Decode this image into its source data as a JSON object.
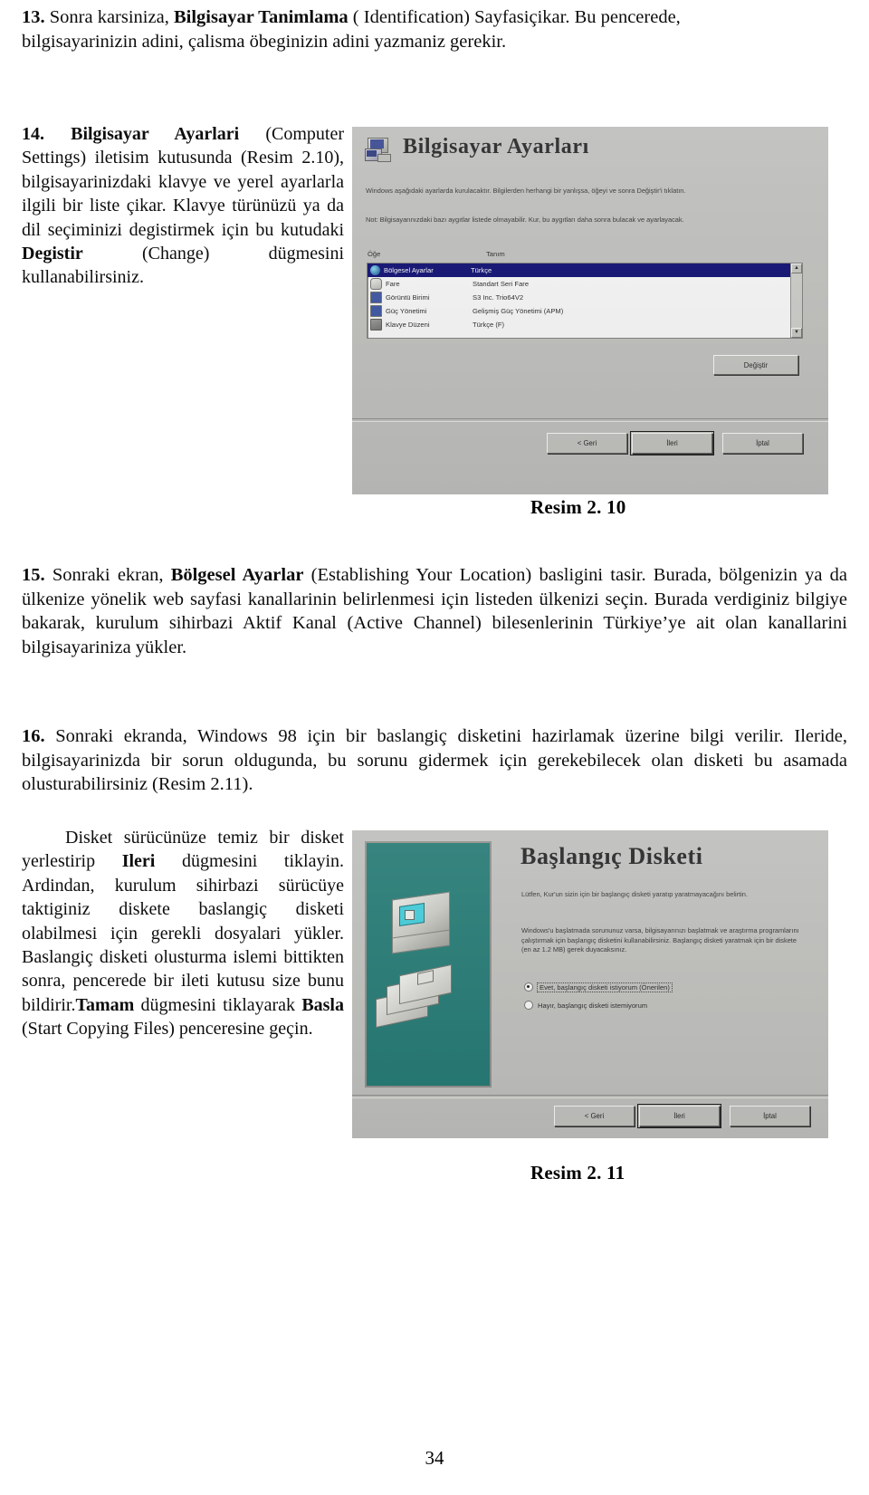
{
  "document": {
    "page_number": "34",
    "language": "tr"
  },
  "paragraphs": {
    "item13": {
      "number": "13.",
      "line1_a": " Sonra karsiniza, ",
      "bold1": "Bilgisayar Tanimlama",
      "line1_b": " ( Identification) Sayfasiçikar. Bu pencerede,",
      "line2": "bilgisayarinizin adini, çalisma öbeginizin adini yazmaniz gerekir."
    },
    "item14": {
      "number": "14.",
      "bold1": " Bilgisayar Ayarlari",
      "text_a": " (Computer Settings) iletisim kutusunda (Resim 2.10), bilgisayarinizdaki klavye ve yerel ayarlarla ilgili bir liste çikar. Klavye türünüzü ya da dil seçiminizi degistirmek için bu kutudaki ",
      "bold2": "Degistir",
      "text_b": " (Change) dügmesini kullanabilirsiniz."
    },
    "item15": {
      "number": "15.",
      "text_a": " Sonraki ekran, ",
      "bold1": "Bölgesel Ayarlar",
      "text_b": " (Establishing Your Location) basligini tasir.  Burada, bölgenizin ya da ülkenize yönelik web sayfasi kanallarinin belirlenmesi için listeden ülkenizi seçin.  Burada verdiginiz bilgiye bakarak, kurulum sihirbazi Aktif Kanal (Active Channel) bilesenlerinin Türkiye’ye ait olan kanallarini bilgisayariniza yükler."
    },
    "item16": {
      "number": "16.",
      "text": " Sonraki ekranda, Windows 98 için bir baslangiç disketini hazirlamak üzerine bilgi verilir. Ileride, bilgisayarinizda bir sorun oldugunda, bu sorunu gidermek için gerekebilecek olan disketi bu asamada olusturabilirsiniz (Resim 2.11)."
    },
    "item17": {
      "text_a": "Disket sürücünüze temiz bir disket yerlestirip ",
      "bold1": "Ileri",
      "text_b": " dügmesini tiklayin. Ardindan, kurulum sihirbazi sürücüye taktiginiz diskete baslangiç disketi olabilmesi için gerekli dosyalari yükler. Baslangiç disketi olusturma islemi bittikten sonra, pencerede bir ileti kutusu size bunu bildirir.",
      "bold2": "Tamam",
      "text_c": " dügmesini tiklayarak ",
      "bold3": "Basla",
      "text_d": " (Start Copying Files) penceresine geçin."
    }
  },
  "figures": {
    "fig_210": {
      "caption": "Resim 2. 10",
      "dialog": {
        "title": "Bilgisayar Ayarları",
        "icon": "computer-settings-icon",
        "body_text_1": "Windows aşağıdaki ayarlarda kurulacaktır. Bilgilerden herhangi bir yanlışsa, öğeyi ve sonra Değiştir'i tıklatın.",
        "body_text_2": "Not: Bilgisayarınızdaki bazı aygıtlar listede olmayabilir. Kur, bu aygıtları daha sonra bulacak ve ayarlayacak.",
        "columns": [
          "Öğe",
          "Tanım"
        ],
        "rows": [
          {
            "name": "Bölgesel Ayarlar",
            "desc": "Türkçe",
            "icon": "globe-icon",
            "selected": true
          },
          {
            "name": "Fare",
            "desc": "Standart Seri Fare",
            "icon": "mouse-icon",
            "selected": false
          },
          {
            "name": "Görüntü Birimi",
            "desc": "S3 Inc. Trio64V2",
            "icon": "display-icon",
            "selected": false
          },
          {
            "name": "Güç Yönetimi",
            "desc": "Gelişmiş Güç Yönetimi (APM)",
            "icon": "power-icon",
            "selected": false
          },
          {
            "name": "Klavye Düzeni",
            "desc": "Türkçe (F)",
            "icon": "keyboard-icon",
            "selected": false
          }
        ],
        "change_button": "Değiştir",
        "buttons": {
          "back": "< Geri",
          "next": "İleri",
          "cancel": "İptal"
        }
      }
    },
    "fig_211": {
      "caption": "Resim 2. 11",
      "dialog": {
        "title": "Başlangıç Disketi",
        "icon": "startup-disk-icon",
        "body_text_1": "Lütfen, Kur'un sizin için bir başlangıç disketi yaratıp yaratmayacağını belirtin.",
        "body_text_2": "Windows'u başlatmada sorununuz varsa, bilgisayarınızı başlatmak ve araştırma programlarını çalıştırmak için başlangıç disketini kullanabilirsiniz. Başlangıç disketi yaratmak için bir diskete (en az 1.2 MB) gerek duyacaksınız.",
        "options": [
          {
            "label": "Evet, başlangıç disketi istiyorum (Önerilen)",
            "selected": true
          },
          {
            "label": "Hayır, başlangıç disketi istemiyorum",
            "selected": false
          }
        ],
        "buttons": {
          "back": "< Geri",
          "next": "İleri",
          "cancel": "İptal"
        }
      }
    }
  },
  "colors": {
    "dialog_face": "#c3c3c0",
    "selection_blue": "#000080",
    "art_teal": "#0e7b74",
    "text": "#0d0d0d"
  }
}
